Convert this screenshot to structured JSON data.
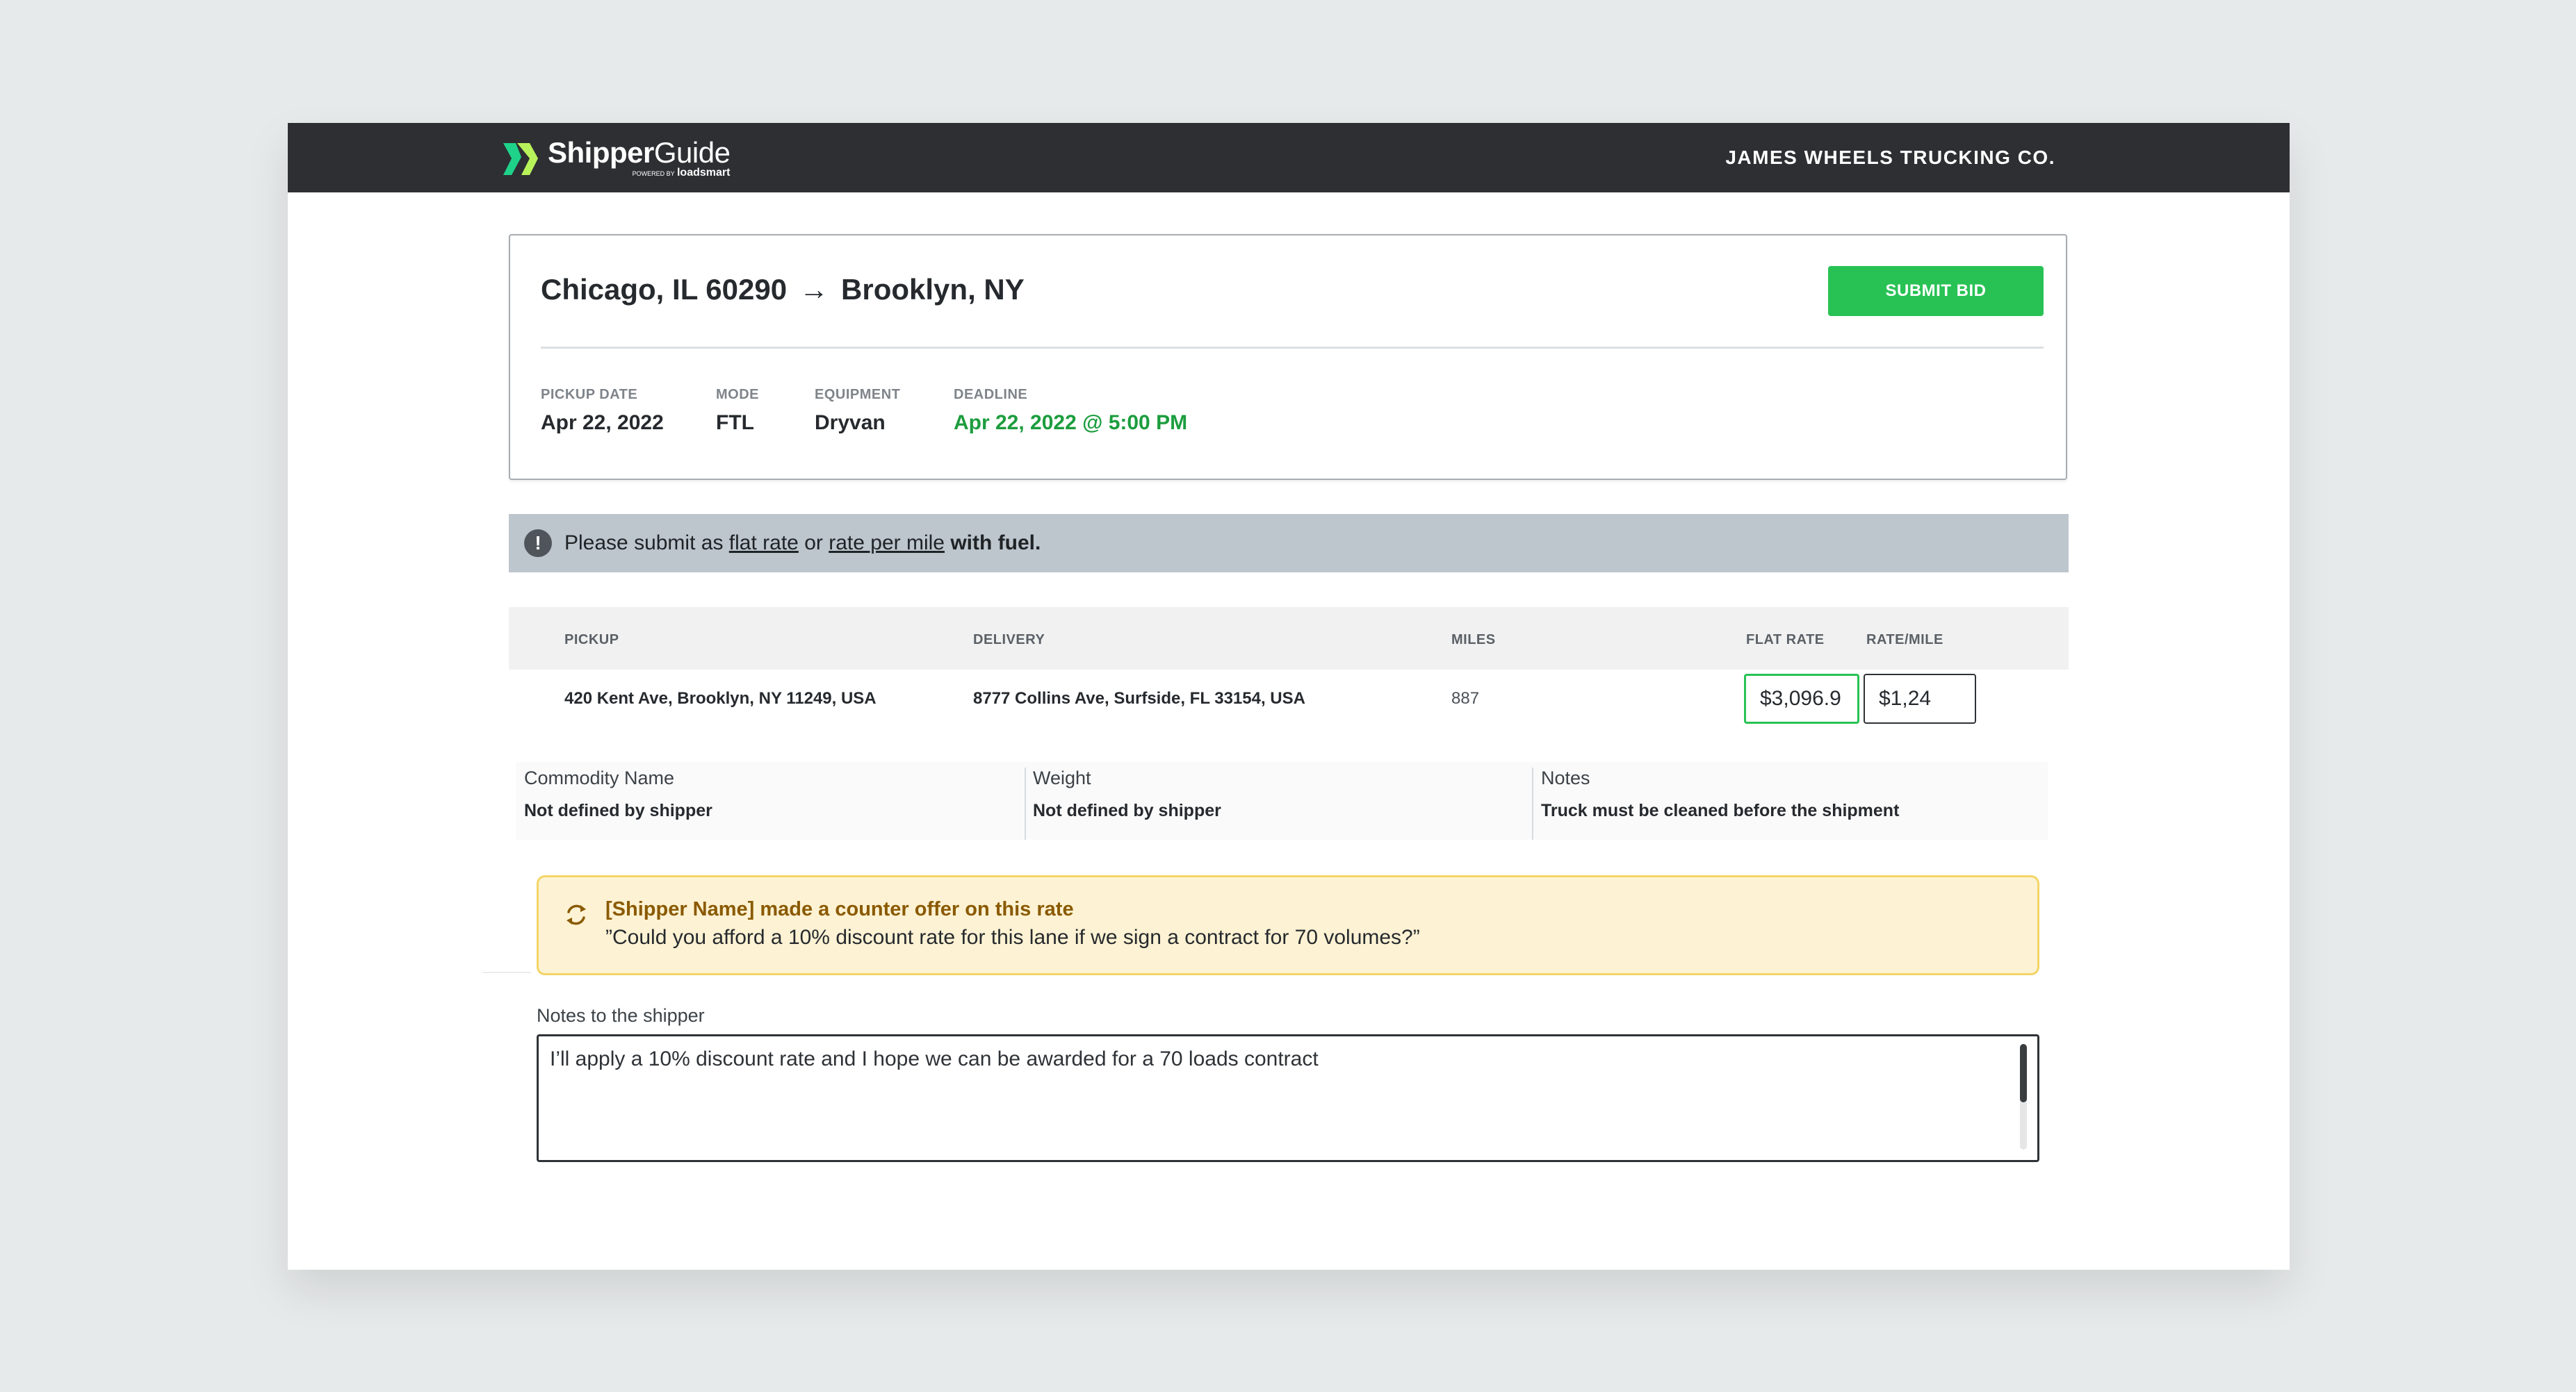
{
  "header": {
    "brand_bold": "Shipper",
    "brand_regular": "Guide",
    "brand_sub_prefix": "POWERED BY",
    "brand_sub_name": "loadsmart",
    "company": "JAMES WHEELS TRUCKING CO."
  },
  "shipment": {
    "origin": "Chicago, IL 60290",
    "arrow": "→",
    "destination": "Brooklyn, NY",
    "submit_label": "SUBMIT BID",
    "meta": [
      {
        "label": "PICKUP DATE",
        "value": "Apr 22, 2022"
      },
      {
        "label": "MODE",
        "value": "FTL"
      },
      {
        "label": "EQUIPMENT",
        "value": "Dryvan"
      },
      {
        "label": "DEADLINE",
        "value": "Apr 22, 2022 @ 5:00 PM"
      }
    ]
  },
  "alert": {
    "prefix": "Please submit as",
    "link1": "flat rate",
    "mid": "or",
    "link2": "rate per mile",
    "suffix": "with fuel."
  },
  "table": {
    "columns": [
      "PICKUP",
      "DELIVERY",
      "MILES",
      "FLAT RATE",
      "RATE/MILE"
    ],
    "row": {
      "pickup": "420 Kent Ave, Brooklyn, NY 11249, USA",
      "delivery": "8777 Collins Ave, Surfside, FL 33154, USA",
      "miles": "887",
      "flat_rate": "$3,096.9",
      "rate_mile": "$1,24"
    }
  },
  "details": [
    {
      "label": "Commodity Name",
      "value": "Not defined by shipper"
    },
    {
      "label": "Weight",
      "value": "Not defined by shipper"
    },
    {
      "label": "Notes",
      "value": "Truck must be cleaned before the shipment"
    }
  ],
  "counter_offer": {
    "title": "[Shipper Name] made a counter offer on this rate",
    "quote": "”Could you afford a 10% discount rate for this lane if we sign a contract for 70 volumes?”"
  },
  "notes_to_shipper": {
    "label": "Notes to the shipper",
    "value": "I’ll apply a 10% discount rate and I hope we can be awarded for a 70 loads contract"
  },
  "colors": {
    "accent_green": "#28c254",
    "deadline_green": "#1c9d3e",
    "topbar": "#2e2f33",
    "counter_bg": "#fdf2d3",
    "counter_border": "#f3d567"
  }
}
